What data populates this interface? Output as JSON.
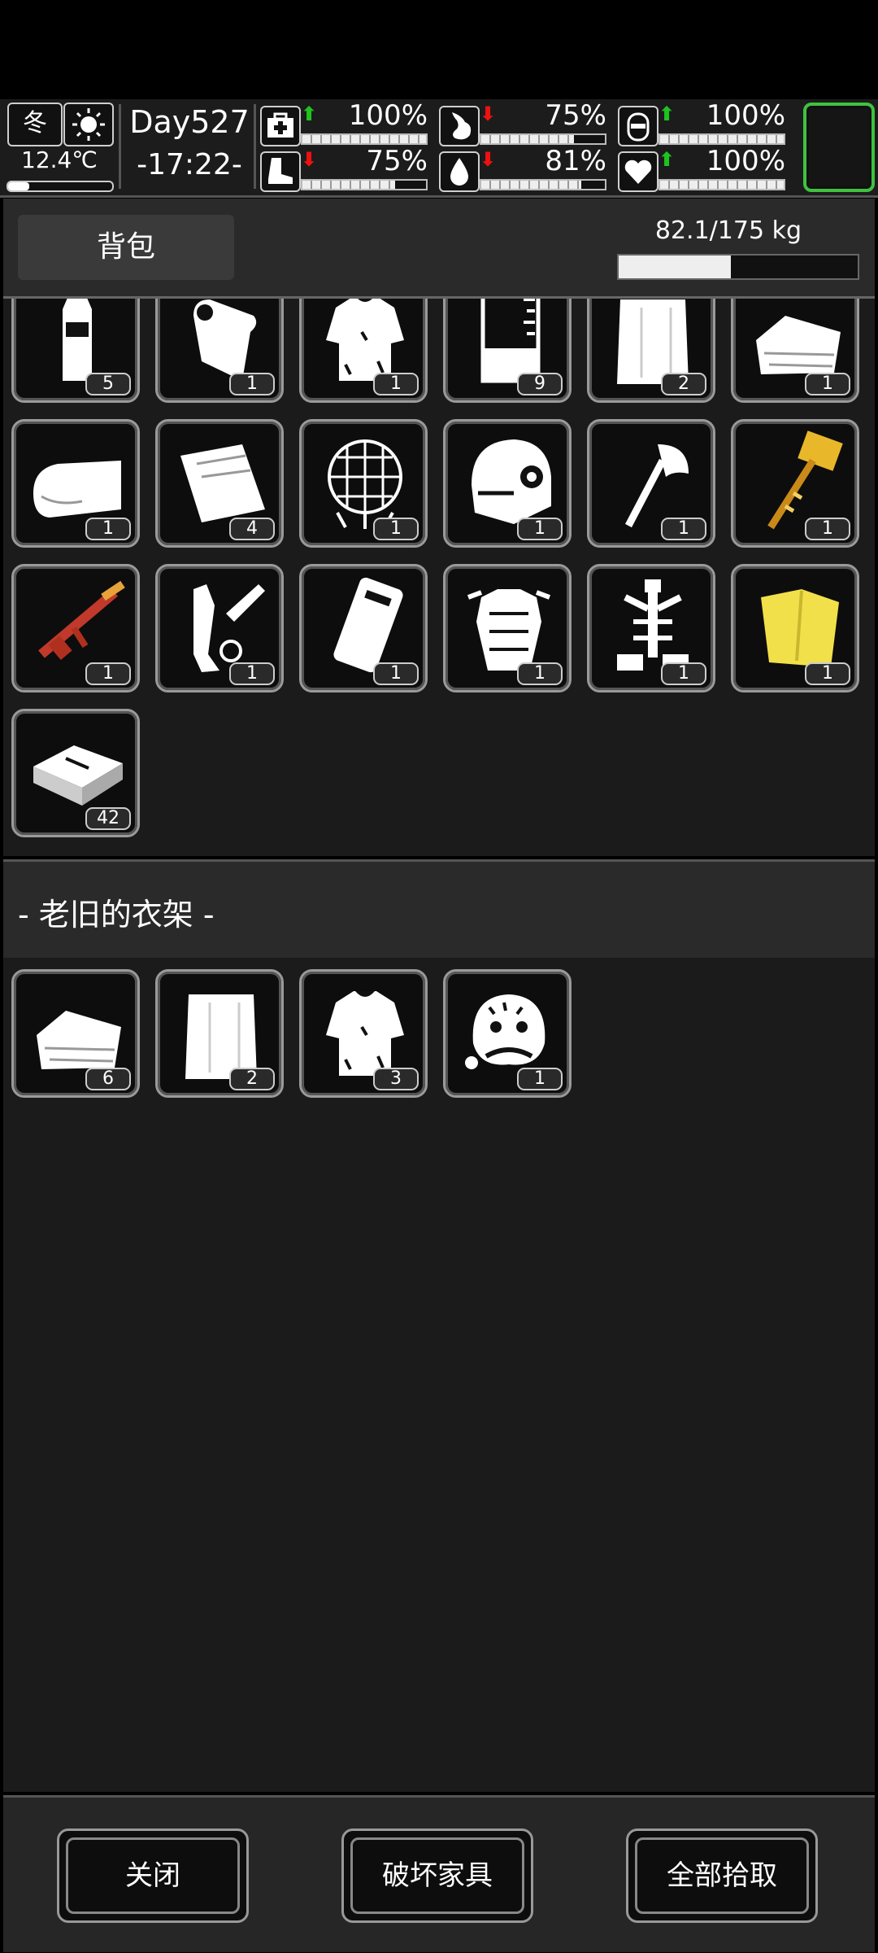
{
  "hud": {
    "season": "冬",
    "weather_icon": "sun-icon",
    "temperature": "12.4℃",
    "temperature_level": 0.2,
    "day": "Day527",
    "time": "-17:22-",
    "stats": [
      {
        "icon": "medkit-icon",
        "trend": "up",
        "value": "100%",
        "level": 1.0
      },
      {
        "icon": "stomach-icon",
        "trend": "down",
        "value": "75%",
        "level": 0.75
      },
      {
        "icon": "bladder-icon",
        "trend": "up",
        "value": "100%",
        "level": 1.0
      },
      {
        "icon": "boot-icon",
        "trend": "down",
        "value": "75%",
        "level": 0.75
      },
      {
        "icon": "water-drop-icon",
        "trend": "down",
        "value": "81%",
        "level": 0.81
      },
      {
        "icon": "heart-icon",
        "trend": "up",
        "value": "100%",
        "level": 1.0
      }
    ],
    "slot_color": "#3fc23f"
  },
  "backpack": {
    "tab_label": "背包",
    "weight": "82.1/175 kg",
    "weight_fraction": 0.469,
    "items": [
      {
        "icon": "water-bottle-icon",
        "count": "5"
      },
      {
        "icon": "cloth-roll-icon",
        "count": "1"
      },
      {
        "icon": "ragged-shirt-icon",
        "count": "1"
      },
      {
        "icon": "beaker-icon",
        "count": "9"
      },
      {
        "icon": "sack-icon",
        "count": "2"
      },
      {
        "icon": "folded-cloth-icon",
        "count": "1"
      },
      {
        "icon": "towel-icon",
        "count": "1"
      },
      {
        "icon": "wrap-food-icon",
        "count": "4"
      },
      {
        "icon": "net-icon",
        "count": "1"
      },
      {
        "icon": "helmet-icon",
        "count": "1"
      },
      {
        "icon": "axe-icon",
        "count": "1"
      },
      {
        "icon": "golden-hammer-icon",
        "count": "1"
      },
      {
        "icon": "red-rifle-icon",
        "count": "1"
      },
      {
        "icon": "crossbow-parts-icon",
        "count": "1"
      },
      {
        "icon": "phone-device-icon",
        "count": "1"
      },
      {
        "icon": "body-armor-icon",
        "count": "1"
      },
      {
        "icon": "exoskeleton-icon",
        "count": "1"
      },
      {
        "icon": "yellow-raincoat-icon",
        "count": "1"
      },
      {
        "icon": "cash-box-icon",
        "count": "42"
      }
    ]
  },
  "container": {
    "title": "- 老旧的衣架 -",
    "items": [
      {
        "icon": "folded-cloth-icon",
        "count": "6"
      },
      {
        "icon": "sack-icon",
        "count": "2"
      },
      {
        "icon": "ragged-shirt-icon",
        "count": "3"
      },
      {
        "icon": "animal-hat-icon",
        "count": "1"
      }
    ]
  },
  "footer": {
    "close_label": "关闭",
    "destroy_label": "破坏家具",
    "take_all_label": "全部拾取"
  }
}
